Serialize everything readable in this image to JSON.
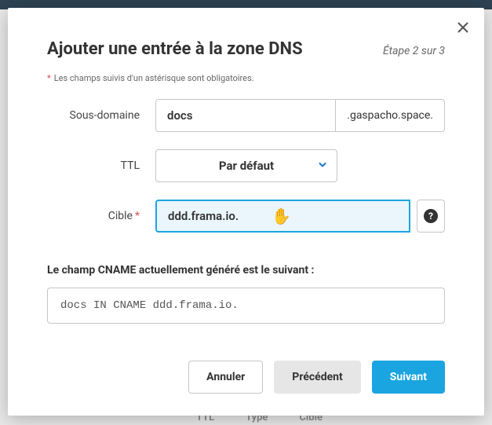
{
  "modal": {
    "title": "Ajouter une entrée à la zone DNS",
    "step": "Étape 2 sur 3",
    "required_note": "Les champs suivis d'un astérisque sont obligatoires."
  },
  "form": {
    "subdomain": {
      "label": "Sous-domaine",
      "value": "docs",
      "suffix": ".gaspacho.space."
    },
    "ttl": {
      "label": "TTL",
      "selected": "Par défaut"
    },
    "target": {
      "label": "Cible",
      "value": "ddd.frama.io.",
      "help_glyph": "?"
    }
  },
  "generated": {
    "label": "Le champ CNAME actuellement généré est le suivant :",
    "value": "docs IN CNAME ddd.frama.io."
  },
  "buttons": {
    "cancel": "Annuler",
    "prev": "Précédent",
    "next": "Suivant"
  },
  "backdrop": {
    "col_ttl": "TTL",
    "col_type": "Type",
    "col_target": "Cible"
  }
}
